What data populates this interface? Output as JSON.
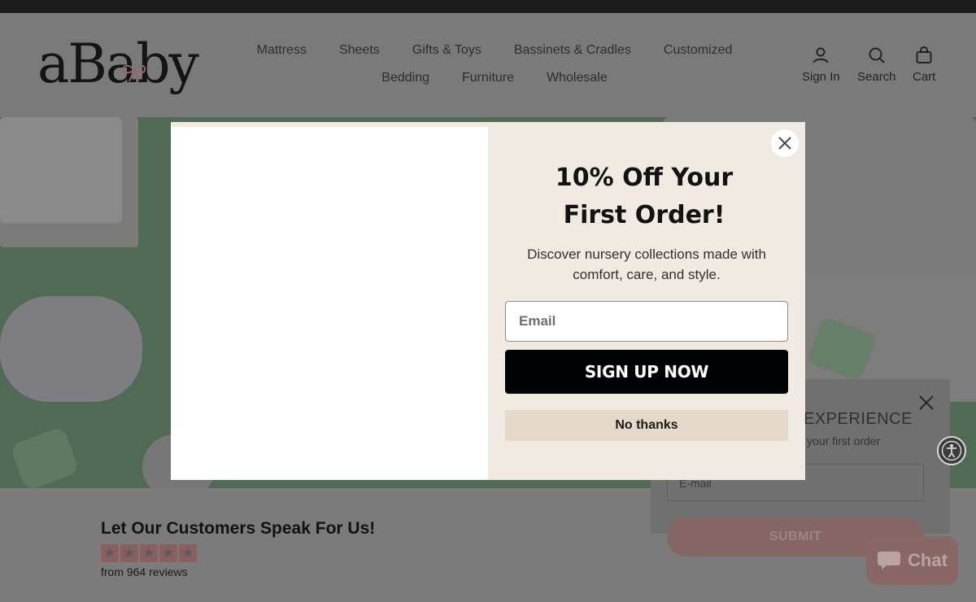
{
  "header": {
    "logo_text": "aBaby",
    "nav": [
      "Mattress",
      "Sheets",
      "Gifts & Toys",
      "Bassinets & Cradles",
      "Customized",
      "Bedding",
      "Furniture",
      "Wholesale"
    ],
    "sign_in_label": "Sign In",
    "search_label": "Search",
    "cart_label": "Cart"
  },
  "reviews": {
    "title": "Let Our Customers Speak For Us!",
    "rating_stars": 5,
    "count_text": "from 964 reviews"
  },
  "vip_popup": {
    "heading": "EXPERIENCE",
    "subtext": "your first order",
    "email_placeholder": "E-mail",
    "submit_label": "SUBMIT"
  },
  "chat": {
    "label": "Chat"
  },
  "modal": {
    "title": "10% Off Your First Order!",
    "description": "Discover nursery collections made with comfort, care, and style.",
    "email_placeholder": "Email",
    "signup_label": "SIGN UP NOW",
    "no_thanks_label": "No thanks"
  },
  "colors": {
    "topbar": "#1c1c1c",
    "modal_panel": "#f1eae2",
    "signup_button": "#020305",
    "no_thanks_button": "#e5d9c9",
    "logo_bow": "#e7a2a2"
  }
}
